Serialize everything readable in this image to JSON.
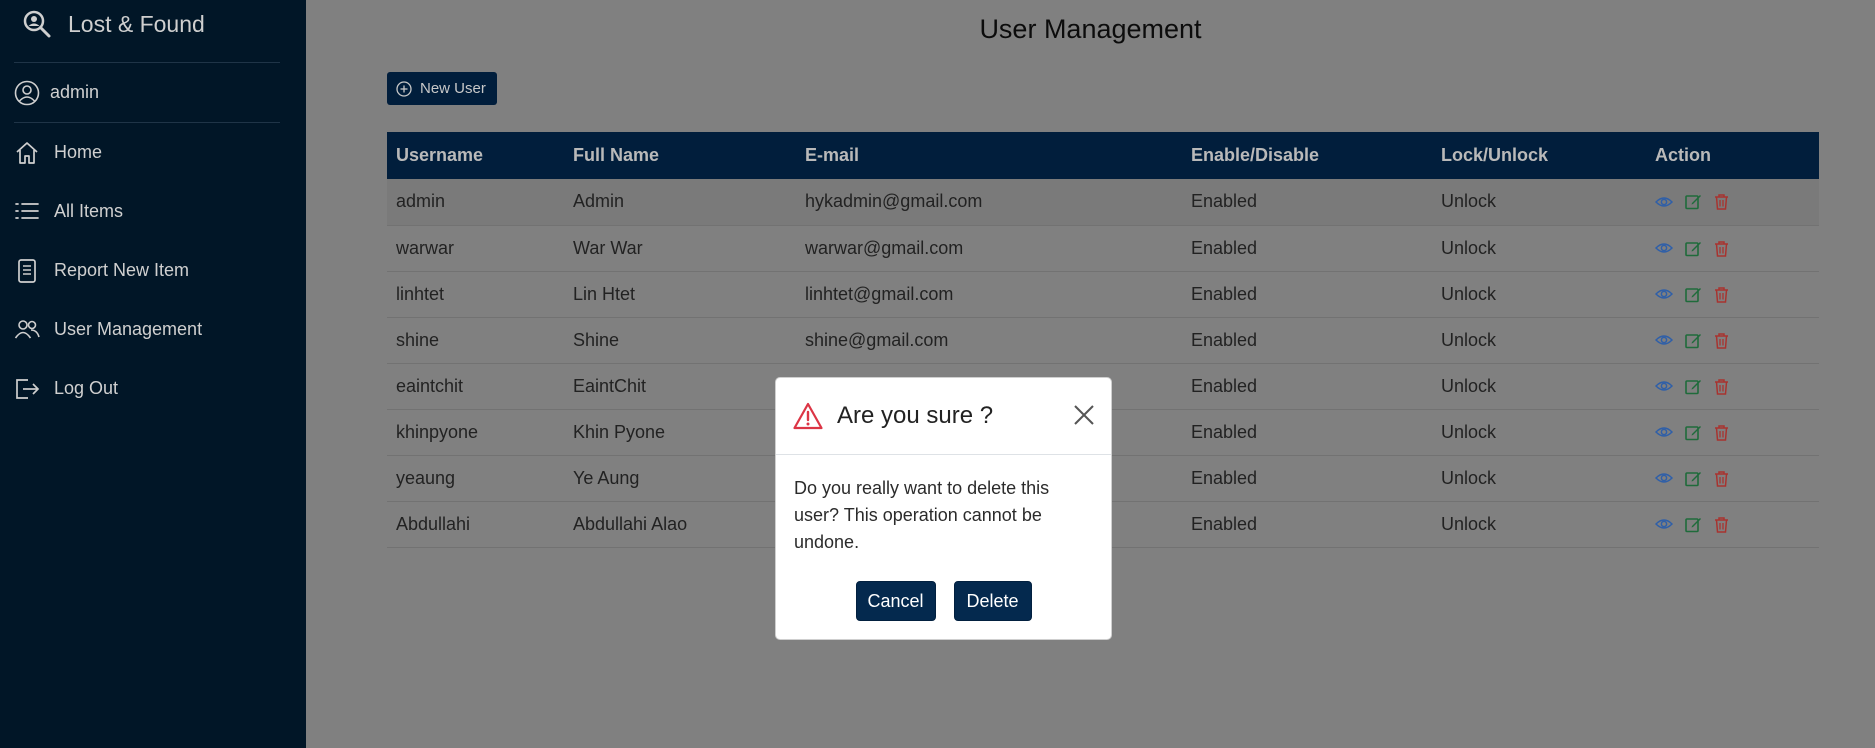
{
  "app": {
    "title": "Lost & Found",
    "current_user": "admin"
  },
  "sidebar": {
    "items": [
      {
        "label": "Home",
        "icon": "home-icon"
      },
      {
        "label": "All Items",
        "icon": "list-icon"
      },
      {
        "label": "Report New Item",
        "icon": "document-icon"
      },
      {
        "label": "User Management",
        "icon": "users-icon"
      },
      {
        "label": "Log Out",
        "icon": "logout-icon"
      }
    ]
  },
  "main": {
    "title": "User Management",
    "new_user_label": "New User",
    "table": {
      "headers": [
        "Username",
        "Full Name",
        "E-mail",
        "Enable/Disable",
        "Lock/Unlock",
        "Action"
      ],
      "rows": [
        [
          "admin",
          "Admin",
          "hykadmin@gmail.com",
          "Enabled",
          "Unlock"
        ],
        [
          "warwar",
          "War War",
          "warwar@gmail.com",
          "Enabled",
          "Unlock"
        ],
        [
          "linhtet",
          "Lin Htet",
          "linhtet@gmail.com",
          "Enabled",
          "Unlock"
        ],
        [
          "shine",
          "Shine",
          "shine@gmail.com",
          "Enabled",
          "Unlock"
        ],
        [
          "eaintchit",
          "EaintChit",
          "",
          "Enabled",
          "Unlock"
        ],
        [
          "khinpyone",
          "Khin Pyone",
          "",
          "Enabled",
          "Unlock"
        ],
        [
          "yeaung",
          "Ye Aung",
          "",
          "Enabled",
          "Unlock"
        ],
        [
          "Abdullahi",
          "Abdullahi Alao",
          "",
          "Enabled",
          "Unlock"
        ]
      ]
    }
  },
  "modal": {
    "title": "Are you sure ?",
    "message": "Do you really want to delete this user? This operation cannot be undone.",
    "cancel_label": "Cancel",
    "delete_label": "Delete"
  },
  "colors": {
    "sidebar_bg": "#011627",
    "header_bg": "#011e3c",
    "view_icon": "#2f5fa8",
    "edit_icon": "#1f6b3b",
    "delete_icon": "#a8332f",
    "warning": "#dc3545"
  }
}
